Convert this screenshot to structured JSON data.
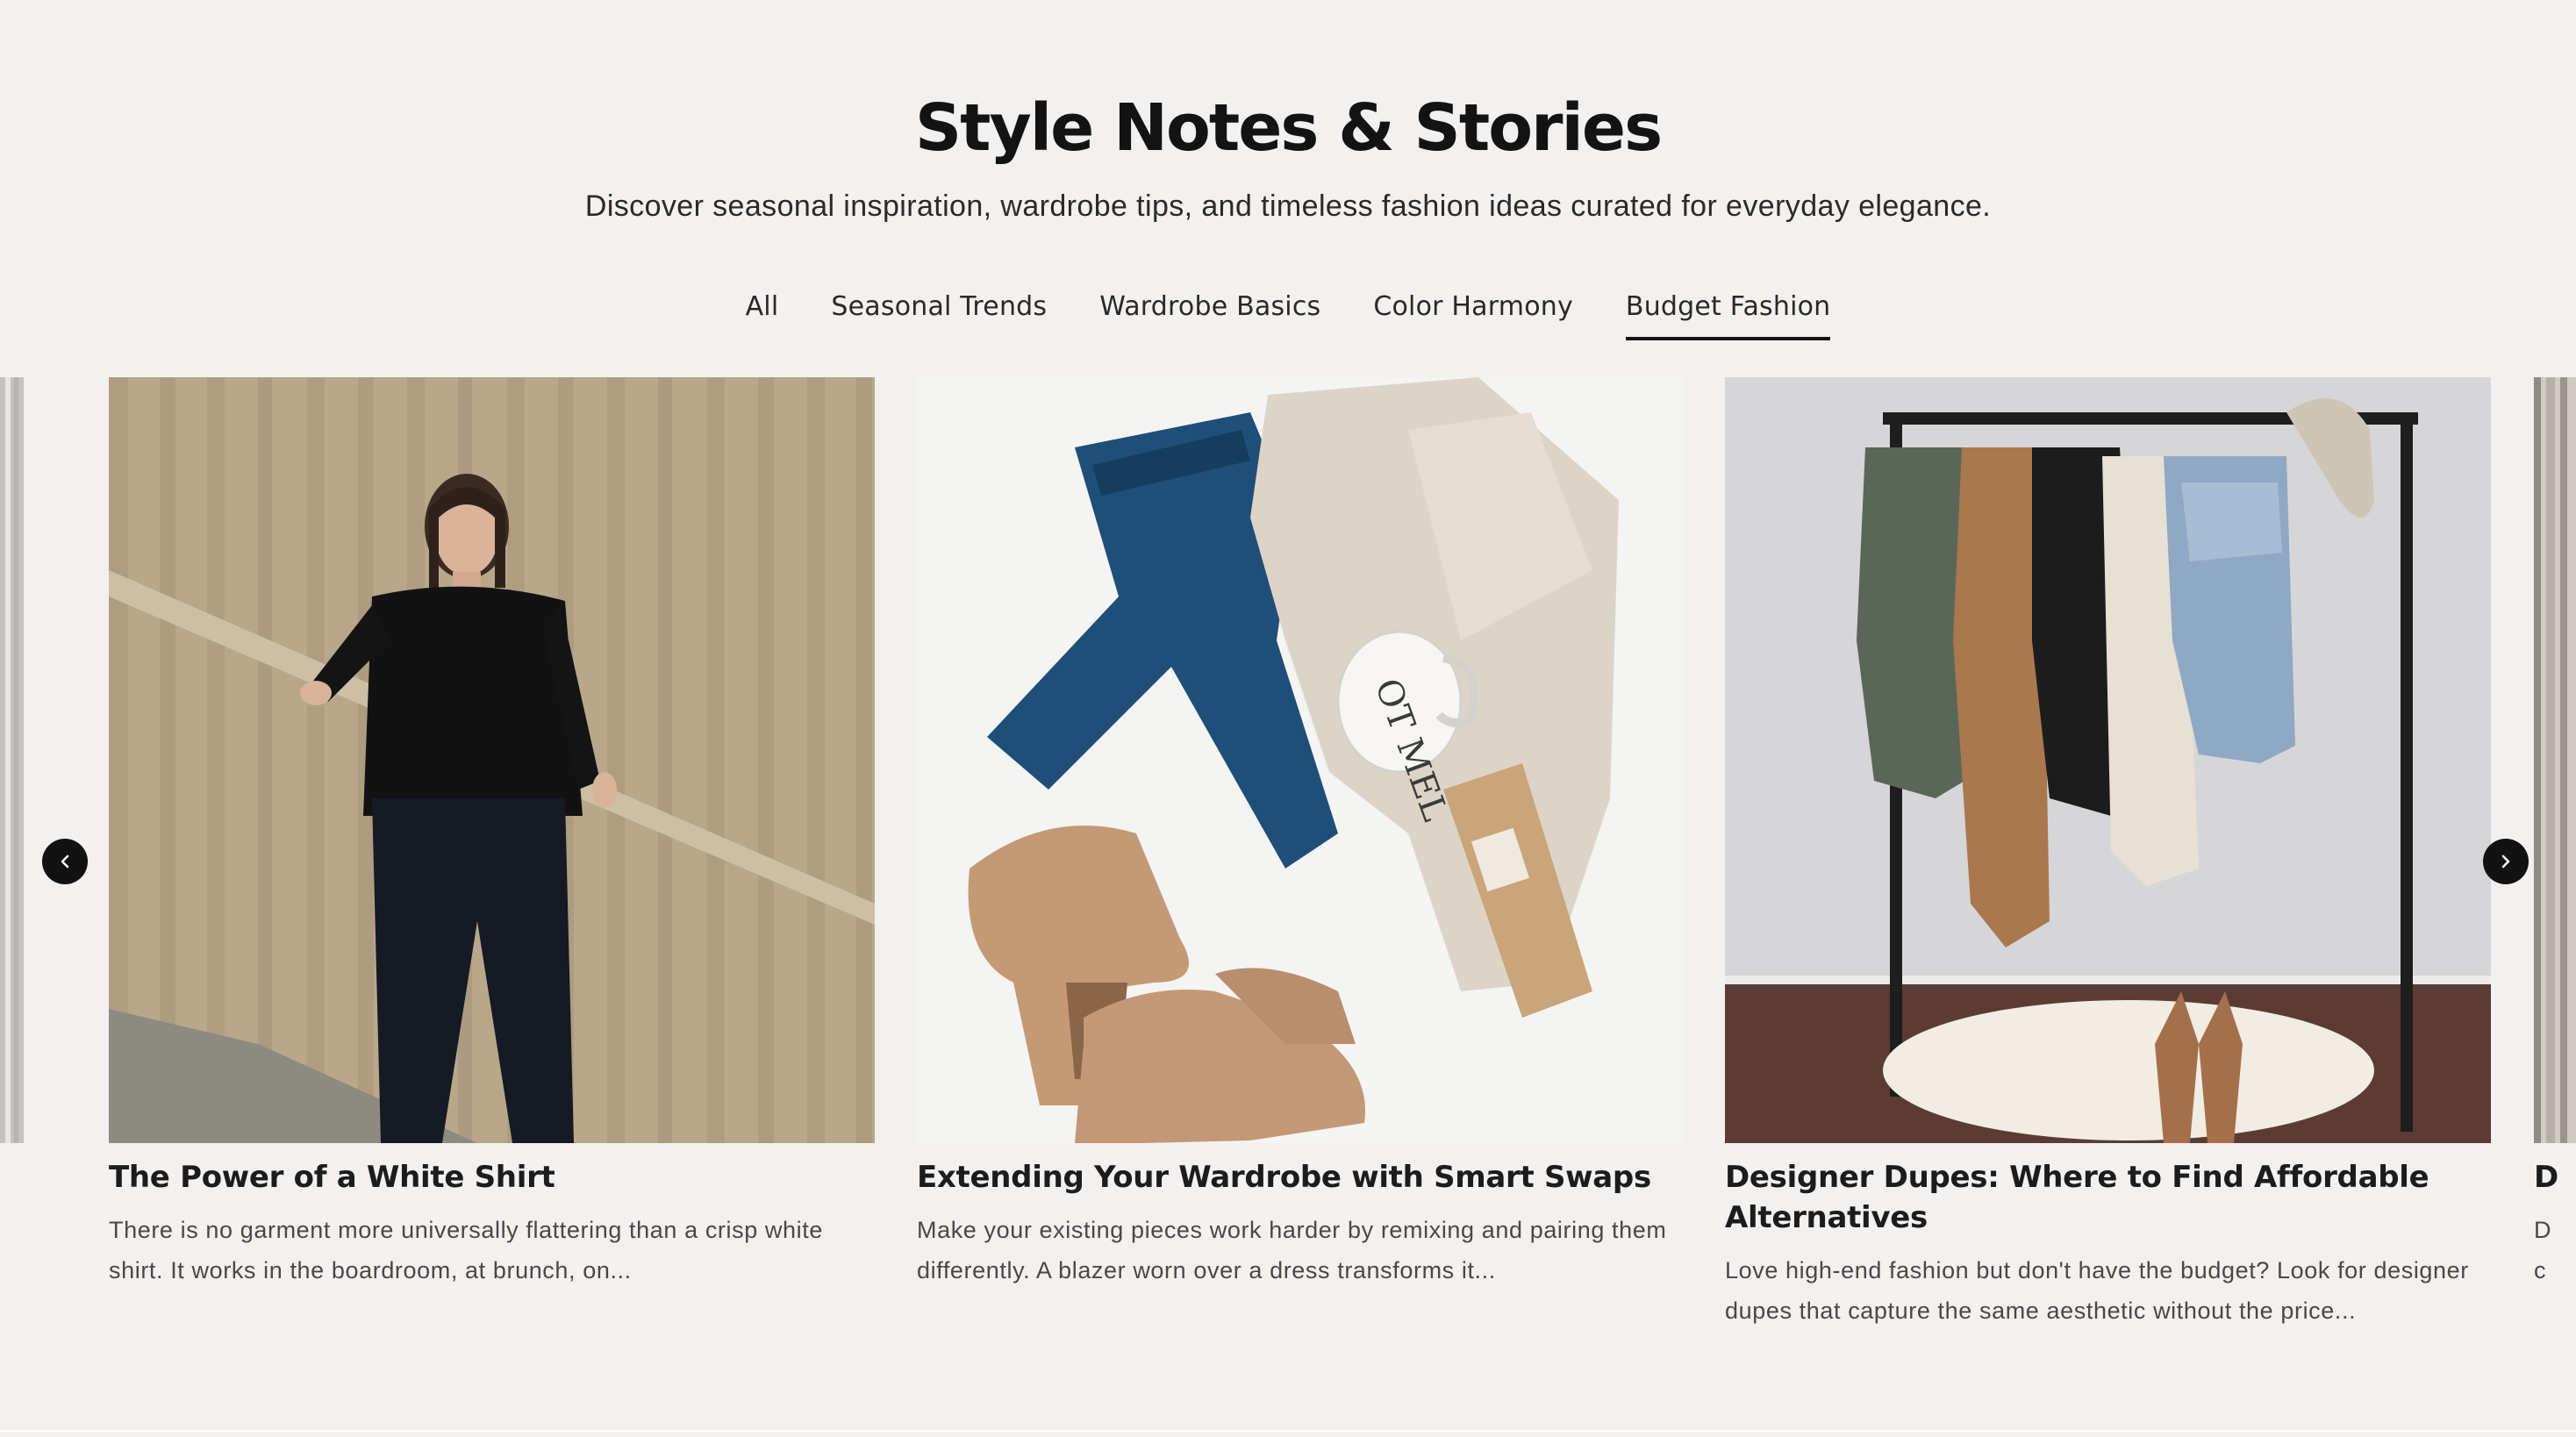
{
  "header": {
    "title": "Style Notes & Stories",
    "subtitle": "Discover seasonal inspiration, wardrobe tips, and timeless fashion ideas curated for everyday elegance."
  },
  "tabs": [
    {
      "label": "All",
      "active": false
    },
    {
      "label": "Seasonal Trends",
      "active": false
    },
    {
      "label": "Wardrobe Basics",
      "active": false
    },
    {
      "label": "Color Harmony",
      "active": false
    },
    {
      "label": "Budget Fashion",
      "active": true
    }
  ],
  "carousel": {
    "prev_icon": "chevron-left-icon",
    "next_icon": "chevron-right-icon",
    "cards": [
      {
        "title": "The Power of a White Shirt",
        "excerpt": "There is no garment more universally flattering than a crisp white shirt. It works in the boardroom, at brunch, on..."
      },
      {
        "title": "Extending Your Wardrobe with Smart Swaps",
        "excerpt": "Make your existing pieces work harder by remixing and pairing them differently. A blazer worn over a dress transforms it..."
      },
      {
        "title": "Designer Dupes: Where to Find Affordable Alternatives",
        "excerpt": "Love high-end fashion but don't have the budget? Look for designer dupes that capture the same aesthetic without the price..."
      }
    ],
    "partial_next_title": "D",
    "partial_next_excerpt_1": "D",
    "partial_next_excerpt_2": "c"
  },
  "colors": {
    "background": "#f3f1ef",
    "text": "#1c1b1b",
    "accent": "#151414"
  }
}
